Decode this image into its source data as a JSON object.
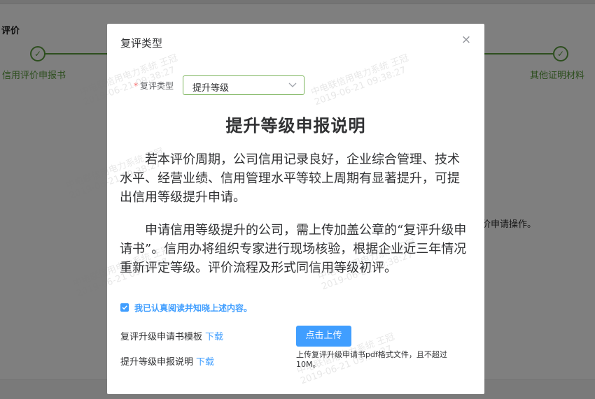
{
  "background": {
    "title": "评价",
    "steps": [
      {
        "label": "信用评价申报书"
      },
      {
        "label": "其他证明材料"
      }
    ],
    "body_text": "价申请操作。"
  },
  "dialog": {
    "title": "复评类型",
    "close_icon": "×",
    "form": {
      "label": "复评类型",
      "required_mark": "*",
      "selected_value": "提升等级"
    },
    "doc_title": "提升等级申报说明",
    "paragraphs": [
      "若本评价周期，公司信用记录良好，企业综合管理、技术水平、经营业绩、信用管理水平等较上周期有显著提升，可提出信用等级提升申请。",
      "申请信用等级提升的公司，需上传加盖公章的“复评升级申请书”。信用办将组织专家进行现场核验，根据企业近三年情况重新评定等级。评价流程及形式同信用等级初评。"
    ],
    "agree_text": "我已认真阅读并知晓上述内容。",
    "downloads": [
      {
        "label": "复评升级申请书模板",
        "link": "下载"
      },
      {
        "label": "提升等级申报说明",
        "link": "下载"
      }
    ],
    "upload_button": "点击上传",
    "upload_tip": "上传复评升级申请书pdf格式文件，且不超过10M。"
  },
  "watermark": {
    "line1": "中电联信用电力系统 王冠",
    "line2": "2019-06-21 09:38:27"
  },
  "colors": {
    "primary": "#409eff",
    "success": "#5a9c3c",
    "danger": "#f56c6c"
  }
}
